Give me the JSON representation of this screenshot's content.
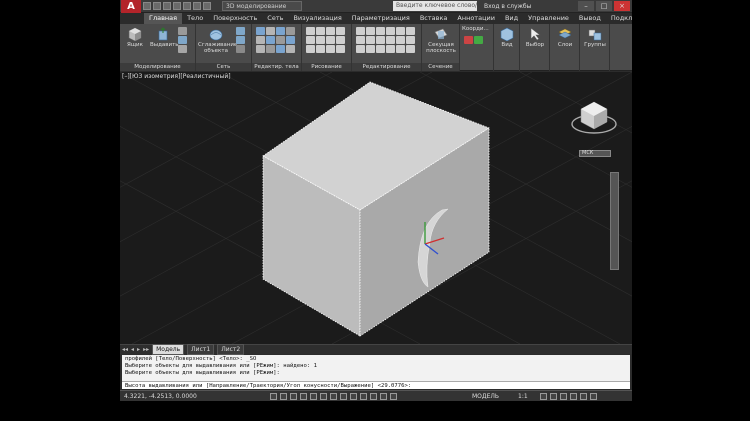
{
  "app": {
    "logo": "A",
    "workspace": "3D моделирование",
    "search_placeholder": "Введите ключевое слово/фразу",
    "signin": "Вход в службы"
  },
  "menu_tabs": [
    "Главная",
    "Тело",
    "Поверхность",
    "Сеть",
    "Визуализация",
    "Параметризация",
    "Вставка",
    "Аннотации",
    "Вид",
    "Управление",
    "Вывод",
    "Подключаемые модули"
  ],
  "ribbon": {
    "box_label": "Ящик",
    "extrude_label": "Выдавить",
    "smooth_label": "Сглаживание объекта",
    "section_plane_label": "Секущая плоскость",
    "coords_label": "Коорди...",
    "view_label": "Вид",
    "select_label": "Выбор",
    "layers_label": "Слои",
    "groups_label": "Группы",
    "panels": [
      "Моделирование",
      "Сеть",
      "Редактир. тела",
      "Рисование",
      "Редактирование",
      "Сечение"
    ]
  },
  "viewport": {
    "label": "[–][ЮЗ изометрия][Реалистичный]",
    "viewcube_label": "МСК"
  },
  "layout_tabs": [
    "Модель",
    "Лист1",
    "Лист2"
  ],
  "command": {
    "lines": [
      "профилей [Тело/Поверхность] <Тело>: _SO",
      "Выберите объекты для выдавливания или [РЕжим]: найдено: 1",
      "Выберите объекты для выдавливания или [РЕжим]:"
    ],
    "prompt": "Высота выдавливания или [Направление/Траектория/Угол конусности/Выражение] <29.0776>:"
  },
  "status": {
    "coordinates": "4.3221, -4.2513, 0.0000",
    "model": "МОДЕЛЬ",
    "scale": "1:1"
  }
}
